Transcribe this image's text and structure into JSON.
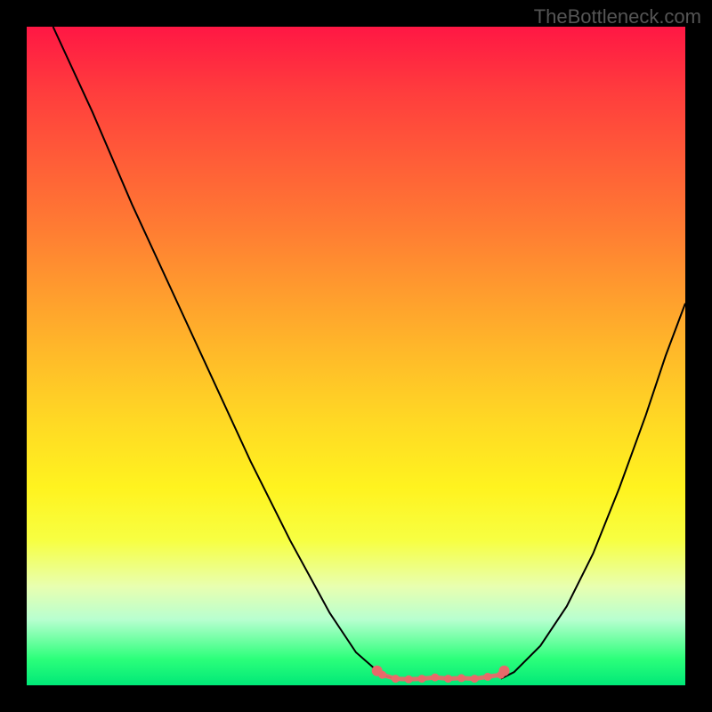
{
  "watermark": "TheBottleneck.com",
  "chart_data": {
    "type": "line",
    "title": "",
    "xlabel": "",
    "ylabel": "",
    "xlim": [
      0,
      100
    ],
    "ylim": [
      0,
      100
    ],
    "series": [
      {
        "name": "left-curve",
        "x": [
          4,
          10,
          16,
          22,
          28,
          34,
          40,
          46,
          50,
          54,
          56
        ],
        "y": [
          100,
          87,
          73,
          60,
          47,
          34,
          22,
          11,
          5,
          1.5,
          1
        ]
      },
      {
        "name": "right-curve",
        "x": [
          72,
          74,
          78,
          82,
          86,
          90,
          94,
          97,
          100
        ],
        "y": [
          1,
          2,
          6,
          12,
          20,
          30,
          41,
          50,
          58
        ]
      },
      {
        "name": "markers-flat",
        "x": [
          54,
          56,
          58,
          60,
          62,
          64,
          66,
          68,
          70,
          72
        ],
        "y": [
          1.6,
          1,
          0.9,
          1,
          1.2,
          1,
          1.1,
          1,
          1.3,
          1.6
        ]
      },
      {
        "name": "markers-ends",
        "x": [
          53.2,
          72.5
        ],
        "y": [
          2.2,
          2.2
        ]
      }
    ],
    "gradient_stops": [
      {
        "pos": 0,
        "color": "#ff1744"
      },
      {
        "pos": 50,
        "color": "#ffbb29"
      },
      {
        "pos": 78,
        "color": "#f7ff42"
      },
      {
        "pos": 100,
        "color": "#00e878"
      }
    ],
    "marker_color": "#e86a6a",
    "line_color": "#000000"
  }
}
